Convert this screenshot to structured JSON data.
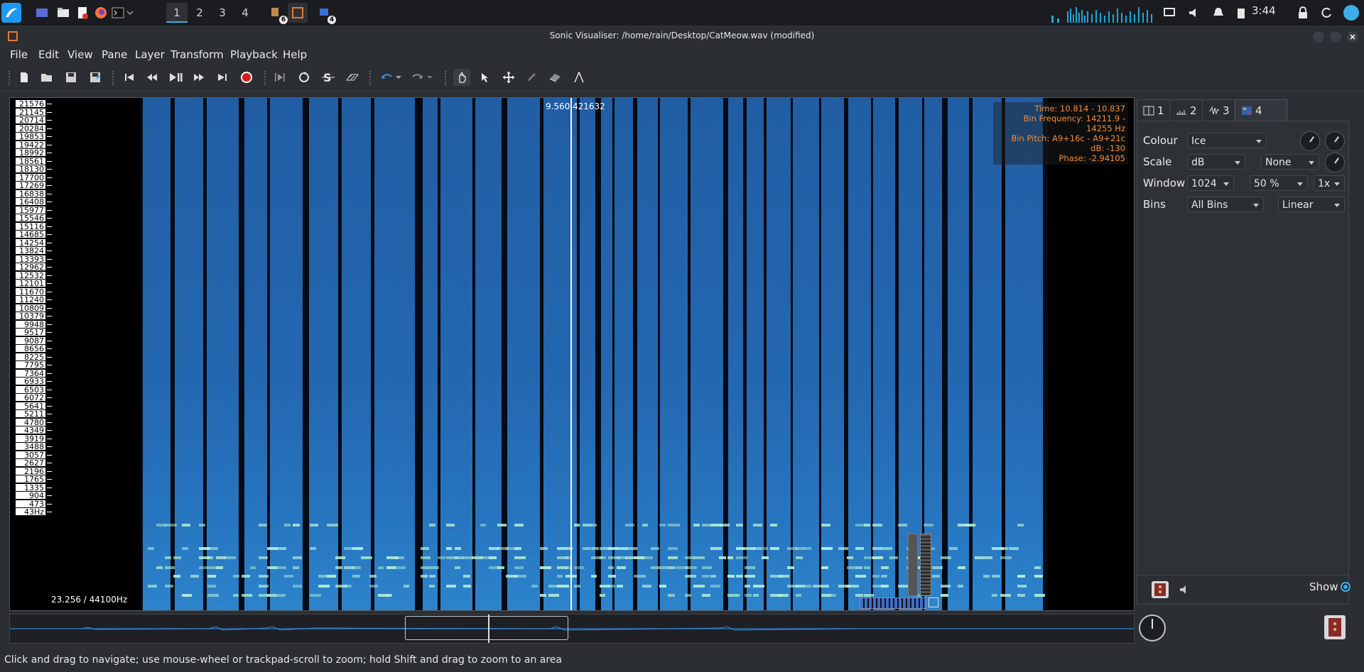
{
  "taskbar": {
    "workspaces": [
      "1",
      "2",
      "3",
      "4"
    ],
    "active_workspace": "1",
    "badges": {
      "app_a": "6",
      "app_c": "4"
    },
    "clock": "3:44"
  },
  "window": {
    "title": "Sonic Visualiser: /home/rain/Desktop/CatMeow.wav (modified)"
  },
  "menu": [
    "File",
    "Edit",
    "View",
    "Pane",
    "Layer",
    "Transform",
    "Playback",
    "Help"
  ],
  "pane": {
    "freq_ticks": [
      "21576",
      "21145",
      "20714",
      "20284",
      "19853",
      "19422",
      "18992",
      "18561",
      "18130",
      "17700",
      "17269",
      "16838",
      "16408",
      "15977",
      "15546",
      "15116",
      "14685",
      "14254",
      "13824",
      "13393",
      "12962",
      "12532",
      "12101",
      "11670",
      "11240",
      "10809",
      "10379",
      "9948",
      "9517",
      "9087",
      "8656",
      "8225",
      "7795",
      "7364",
      "6933",
      "6503",
      "6072",
      "5641",
      "5211",
      "4780",
      "4349",
      "3919",
      "3488",
      "3057",
      "2627",
      "2196",
      "1765",
      "1335",
      "904",
      "473",
      "43Hz"
    ],
    "cursor_time": "9.560",
    "cursor_frame": "421632",
    "info": {
      "time": "Time: 10.814 - 10.837",
      "bin_frequency": "Bin Frequency: 14211.9 - 14255 Hz",
      "bin_pitch": "Bin Pitch: A9+16c - A9+21c",
      "db": "dB: -130",
      "phase": "Phase: -2.94105"
    },
    "rate_label": "23.256 / 44100Hz"
  },
  "props": {
    "tabs": [
      "1",
      "2",
      "3",
      "4"
    ],
    "active_tab": "4",
    "rows": {
      "colour": {
        "label": "Colour",
        "value": "Ice"
      },
      "scale": {
        "label": "Scale",
        "value": "dB",
        "value2": "None"
      },
      "window": {
        "label": "Window",
        "value": "1024",
        "value2": "50 %",
        "value3": "1x"
      },
      "bins": {
        "label": "Bins",
        "value": "All Bins",
        "value2": "Linear"
      }
    },
    "show_label": "Show"
  },
  "status": "Click and drag to navigate; use mouse-wheel or trackpad-scroll to zoom; hold Shift and drag to zoom to an area",
  "colors": {
    "accent": "#3daee9",
    "info_text": "#f28c3a",
    "spectrogram_base": "#1d5fa8"
  }
}
